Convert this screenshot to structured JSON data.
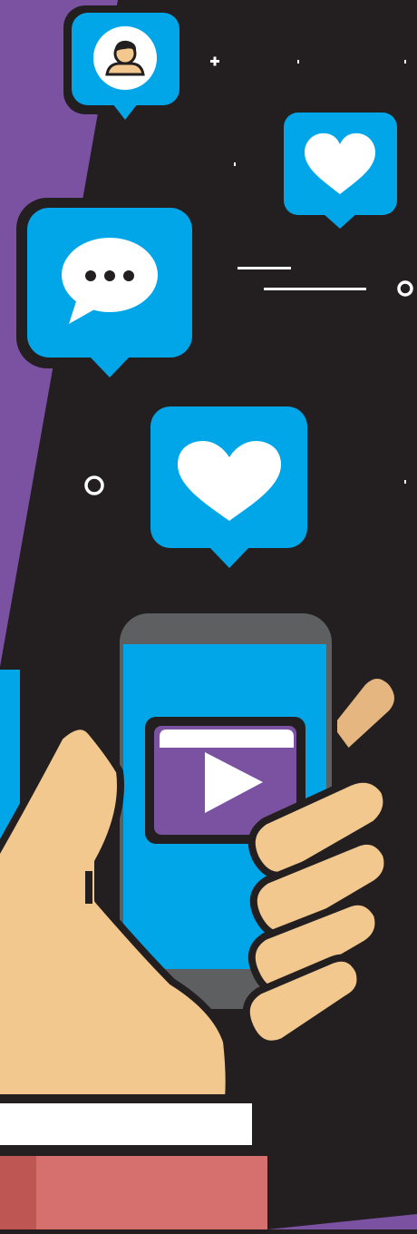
{
  "colors": {
    "background": "#231f20",
    "purple_panel": "#7b52a1",
    "bubble_blue": "#00a6e8",
    "outline": "#231f20",
    "phone_body": "#5e5f61",
    "phone_screen": "#00a6e8",
    "skin": "#f3c88f",
    "skin_shadow": "#e5b67f",
    "video_purple": "#7b52a1",
    "banner_white": "#ffffff",
    "banner_red": "#d5706e",
    "banner_red_dark": "#be5653"
  },
  "icons": {
    "profile_bubble": "user-avatar-icon",
    "like_bubble_top": "heart-icon",
    "comment_bubble": "speech-dots-icon",
    "like_bubble_center": "heart-icon",
    "video_player": "play-icon"
  }
}
